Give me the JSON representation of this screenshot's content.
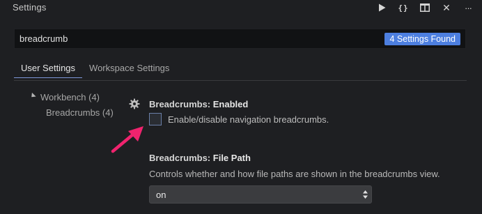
{
  "titlebar": {
    "title": "Settings",
    "actions": [
      {
        "name": "run-icon"
      },
      {
        "name": "braces-icon",
        "glyph": "{}"
      },
      {
        "name": "split-editor-icon"
      },
      {
        "name": "close-icon",
        "glyph": "✕"
      },
      {
        "name": "more-icon",
        "glyph": "···"
      }
    ]
  },
  "search": {
    "value": "breadcrumb",
    "badge": "4 Settings Found"
  },
  "tabs": [
    {
      "label": "User Settings",
      "active": true
    },
    {
      "label": "Workspace Settings",
      "active": false
    }
  ],
  "tree": {
    "parent": "Workbench (4)",
    "child": "Breadcrumbs (4)"
  },
  "settings": [
    {
      "category": "Breadcrumbs:",
      "key": "Enabled",
      "type": "checkbox",
      "checked": false,
      "description": "Enable/disable navigation breadcrumbs."
    },
    {
      "category": "Breadcrumbs:",
      "key": "File Path",
      "type": "select",
      "description": "Controls whether and how file paths are shown in the breadcrumbs view.",
      "value": "on"
    }
  ],
  "colors": {
    "background": "#1e1f22",
    "accent": "#4d7fe0",
    "pointer_arrow": "#f0236e"
  }
}
